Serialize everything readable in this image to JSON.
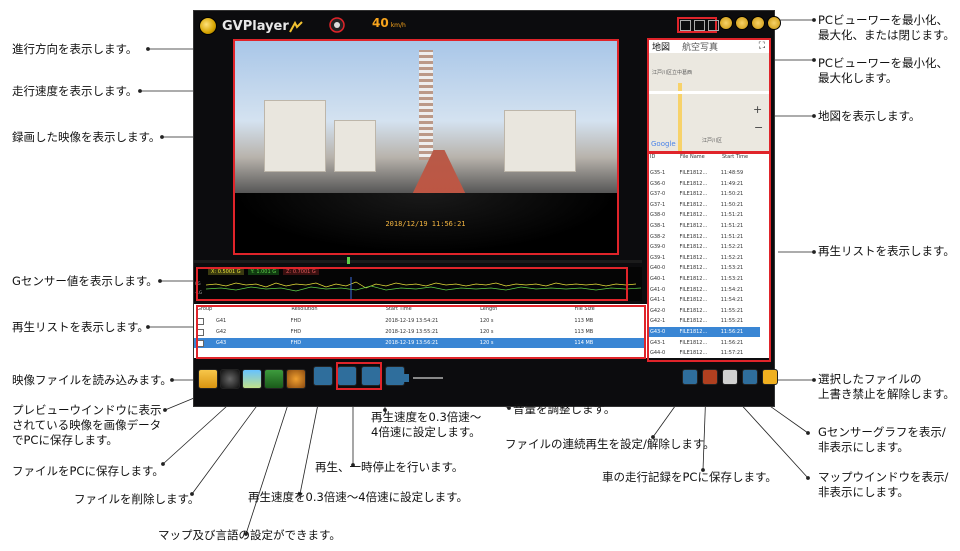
{
  "app": {
    "title": "GVPlayer",
    "speed": "40",
    "speed_unit": "km/h",
    "video_timestamp": "2018/12/19 11:56:21",
    "map_tabs": [
      "地図",
      "航空写真"
    ],
    "map_expand_icon": "expand-icon",
    "map_label_1": "江戸川区立中葛西",
    "map_label_2": "江戸川区",
    "map_logo": "Google",
    "gsensor_legend": [
      "X: 0.5001 G",
      "Y: 1.001 G",
      "Z: 0.7001 G"
    ],
    "gsensor_axes": [
      "0G",
      "-1G"
    ],
    "bottom_table": {
      "headers": [
        "Group",
        "Resolution",
        "Start Time",
        "Length",
        "File Size"
      ],
      "rows": [
        {
          "group": "G41",
          "res": "FHD",
          "start": "2018-12-19 13:54:21",
          "len": "120 s",
          "size": "113 MB"
        },
        {
          "group": "G42",
          "res": "FHD",
          "start": "2018-12-19 13:55:21",
          "len": "120 s",
          "size": "113 MB"
        },
        {
          "group": "G43",
          "res": "FHD",
          "start": "2018-12-19 13:56:21",
          "len": "120 s",
          "size": "114 MB"
        }
      ]
    },
    "right_table": {
      "headers": [
        "ID",
        "File Name",
        "Start Time"
      ],
      "rows": [
        {
          "id": "G35-1",
          "name": "FILE1812...",
          "time": "11:48:59"
        },
        {
          "id": "G36-0",
          "name": "FILE1812...",
          "time": "11:49:21"
        },
        {
          "id": "G37-0",
          "name": "FILE1812...",
          "time": "11:50:21"
        },
        {
          "id": "G37-1",
          "name": "FILE1812...",
          "time": "11:50:21"
        },
        {
          "id": "G38-0",
          "name": "FILE1812...",
          "time": "11:51:21"
        },
        {
          "id": "G38-1",
          "name": "FILE1812...",
          "time": "11:51:21"
        },
        {
          "id": "G38-2",
          "name": "FILE1812...",
          "time": "11:51:21"
        },
        {
          "id": "G39-0",
          "name": "FILE1812...",
          "time": "11:52:21"
        },
        {
          "id": "G39-1",
          "name": "FILE1812...",
          "time": "11:52:21"
        },
        {
          "id": "G40-0",
          "name": "FILE1812...",
          "time": "11:53:21"
        },
        {
          "id": "G40-1",
          "name": "FILE1812...",
          "time": "11:53:21"
        },
        {
          "id": "G41-0",
          "name": "FILE1812...",
          "time": "11:54:21"
        },
        {
          "id": "G41-1",
          "name": "FILE1812...",
          "time": "11:54:21"
        },
        {
          "id": "G42-0",
          "name": "FILE1812...",
          "time": "11:55:21"
        },
        {
          "id": "G42-1",
          "name": "FILE1812...",
          "time": "11:55:21"
        },
        {
          "id": "G43-0",
          "name": "FILE1812...",
          "time": "11:56:21"
        },
        {
          "id": "G43-1",
          "name": "FILE1812...",
          "time": "11:56:21"
        },
        {
          "id": "G44-0",
          "name": "FILE1812...",
          "time": "11:57:21"
        }
      ],
      "selected_index": 15
    },
    "colors": {
      "highlight": "#e0242a",
      "selection": "#3a86d4",
      "background": "#0c0c0e"
    }
  },
  "annotations": {
    "direction": "進行方向を表示します。",
    "speed": "走行速度を表示します。",
    "video": "録画した映像を表示します。",
    "gsensor": "Gセンサー値を表示します。",
    "playlist_bottom": "再生リストを表示します。",
    "load_file": "映像ファイルを読み込みます。",
    "preview_1": "プレビューウインドウに表示",
    "preview_2": "されている映像を画像データ",
    "preview_3": "でPCに保存します。",
    "save_file": "ファイルをPCに保存します。",
    "delete_file": "ファイルを削除します。",
    "settings": "マップ及び言語の設定ができます。",
    "speed_left": "再生速度を0.3倍速～4倍速に設定します。",
    "play_pause": "再生、一時停止を行います。",
    "speed_right_1": "再生速度を0.3倍速～",
    "speed_right_2": "4倍速に設定します。",
    "volume": "音量を調整します。",
    "continuous": "ファイルの連続再生を設定/解除します。",
    "route": "車の走行記録をPCに保存します。",
    "map_toggle_1": "マップウインドウを表示/",
    "map_toggle_2": "非表示にします。",
    "gsensor_toggle_1": "Gセンサーグラフを表示/",
    "gsensor_toggle_2": "非表示にします。",
    "unlock_1": "選択したファイルの",
    "unlock_2": "上書き禁止を解除します。",
    "playlist_right": "再生リストを表示します。",
    "map": "地図を表示します。",
    "viewer_max_1": "PCビューワーを最小化、",
    "viewer_max_2": "最大化します。",
    "viewer_all_1": "PCビューワーを最小化、",
    "viewer_all_2": "最大化、または閉じます。"
  }
}
